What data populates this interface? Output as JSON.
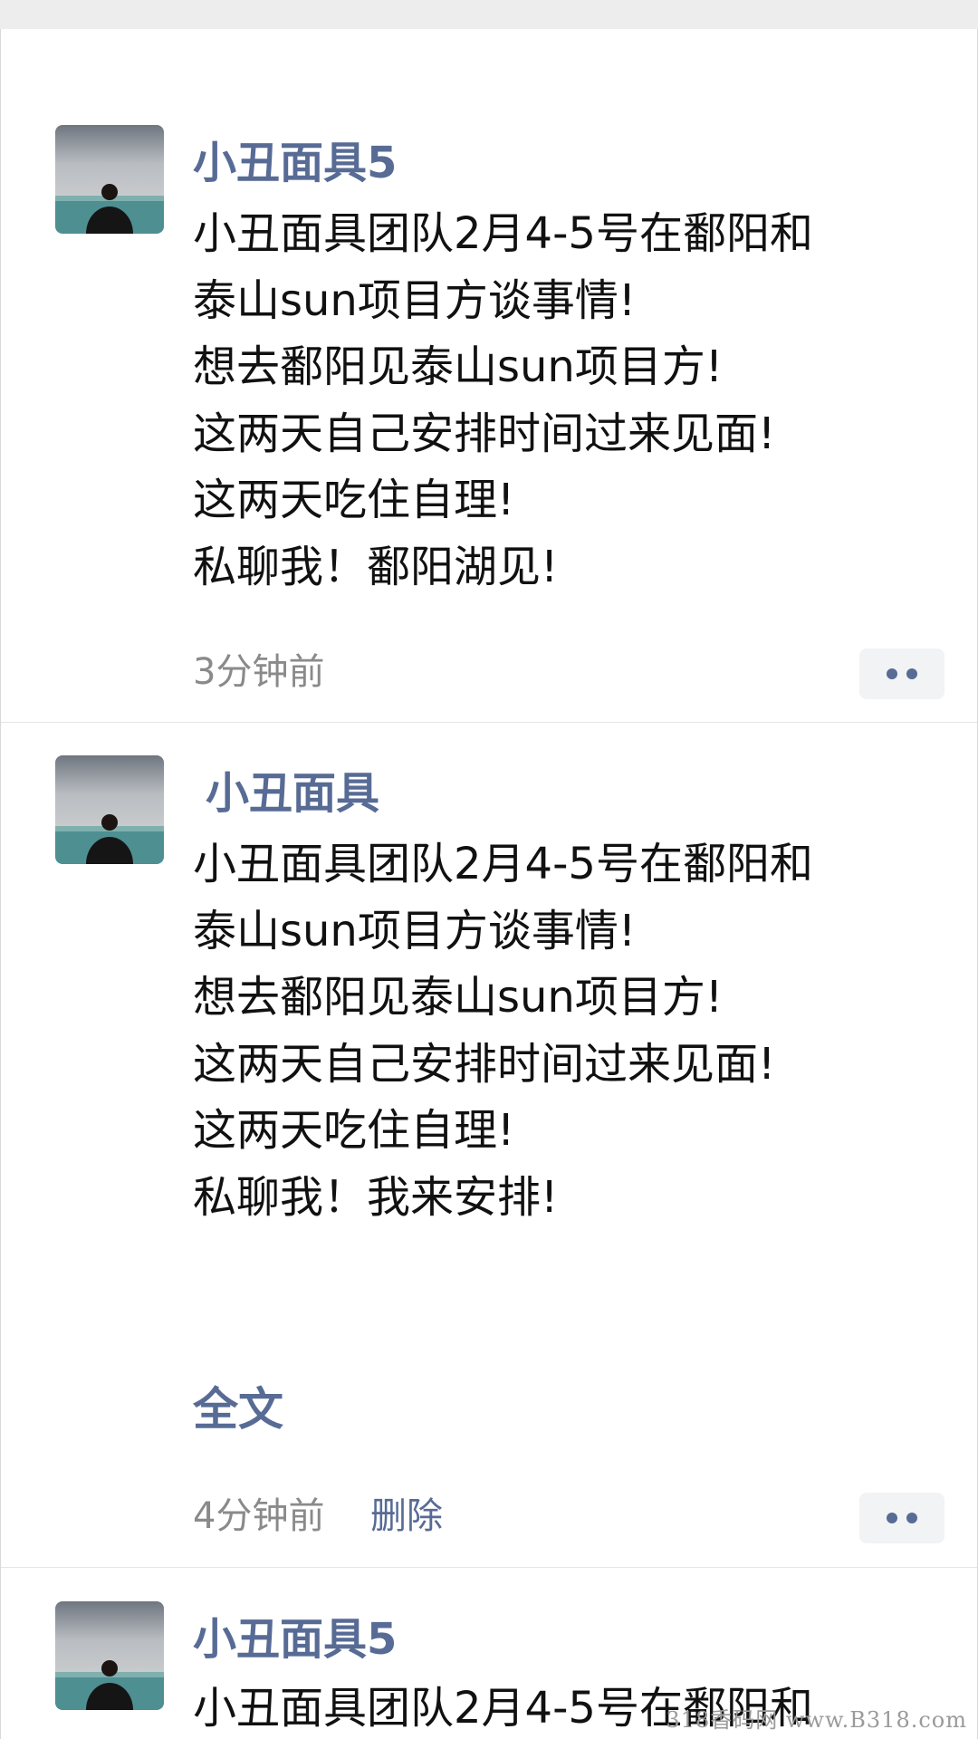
{
  "posts": [
    {
      "username": "小丑面具5",
      "lines": [
        "小丑面具团队2月4-5号在鄱阳和",
        "泰山sun项目方谈事情!",
        "想去鄱阳见泰山sun项目方!",
        "这两天自己安排时间过来见面!",
        "这两天吃住自理!",
        "私聊我！鄱阳湖见!"
      ],
      "time": "3分钟前"
    },
    {
      "username": "小丑面具",
      "lines": [
        "小丑面具团队2月4-5号在鄱阳和",
        "泰山sun项目方谈事情!",
        "想去鄱阳见泰山sun项目方!",
        "这两天自己安排时间过来见面!",
        "这两天吃住自理!",
        "私聊我！我来安排!"
      ],
      "fulltext_label": "全文",
      "time": "4分钟前",
      "delete_label": "删除"
    },
    {
      "username": "小丑面具5",
      "lines": [
        "小丑面具团队2月4-5号在鄱阳和"
      ]
    }
  ],
  "more_icon": "more-dots-icon",
  "watermark": "318香码网 www.B318.com",
  "colors": {
    "link": "#576b95",
    "text": "#111111",
    "time": "#8a8a8a",
    "divider": "#e5e5e5",
    "button_bg": "#f2f3f5"
  }
}
